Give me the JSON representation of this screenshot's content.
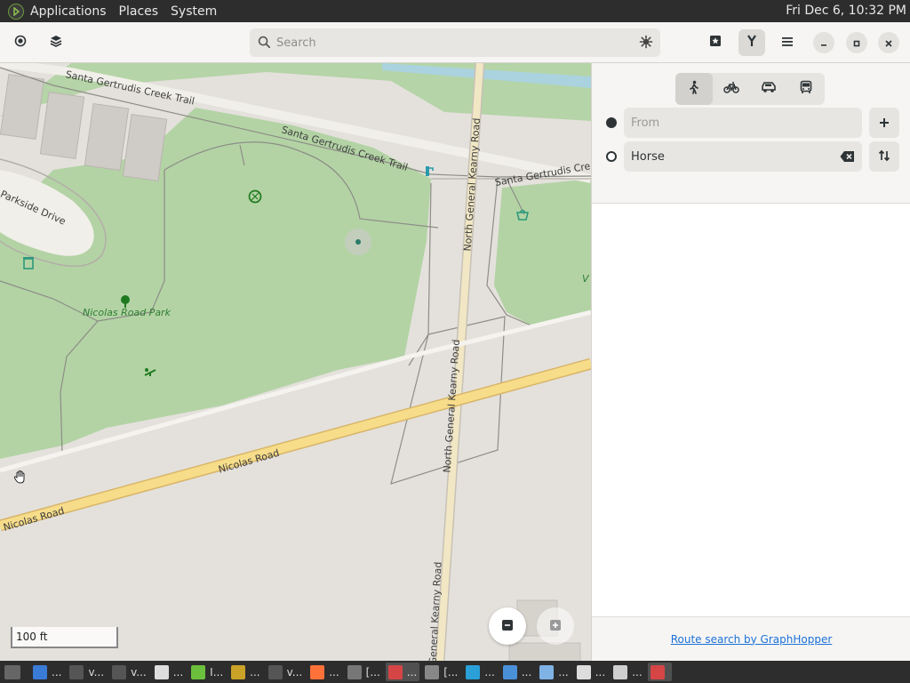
{
  "top_panel": {
    "menus": [
      "Applications",
      "Places",
      "System"
    ],
    "clock": "Fri Dec 6, 10:32 PM"
  },
  "header": {
    "search_placeholder": "Search"
  },
  "map": {
    "labels": {
      "trail_1": "Santa Gertrudis Creek Trail",
      "trail_2": "Santa Gertrudis Creek Trail",
      "trail_3": "Santa Gertrudis Cree",
      "parkside": "Parkside Drive",
      "park": "Nicolas Road Park",
      "kearny_1": "North General Kearny Road",
      "kearny_2": "North General Kearny Road",
      "kearny_3": "General Kearny Road",
      "nicolas_1": "Nicolas Road",
      "nicolas_2": "Nicolas Road",
      "edge_letter": "V"
    },
    "scale": "100 ft"
  },
  "sidebar": {
    "modes": [
      "walk",
      "bike",
      "car",
      "transit"
    ],
    "active_mode": "walk",
    "from_placeholder": "From",
    "to_value": "Horse",
    "footer_link": "Route search by GraphHopper"
  },
  "taskbar": {
    "items": [
      {
        "label": "...",
        "color": "#3a7bd5"
      },
      {
        "label": "v...",
        "color": "#555555"
      },
      {
        "label": "v...",
        "color": "#555555"
      },
      {
        "label": "...",
        "color": "#dddddd"
      },
      {
        "label": "I...",
        "color": "#6cbf3d"
      },
      {
        "label": "...",
        "color": "#c9a227"
      },
      {
        "label": "v...",
        "color": "#555555"
      },
      {
        "label": "...",
        "color": "#ff7139"
      },
      {
        "label": "[...",
        "color": "#777777"
      },
      {
        "label": "...",
        "color": "#d64545"
      },
      {
        "label": "[...",
        "color": "#888888"
      },
      {
        "label": "...",
        "color": "#2a9fd8"
      },
      {
        "label": "...",
        "color": "#4a90d9"
      },
      {
        "label": "...",
        "color": "#7fb2e5"
      },
      {
        "label": "...",
        "color": "#dddddd"
      },
      {
        "label": "...",
        "color": "#cfcfcf"
      },
      {
        "label": "",
        "color": "#d64545"
      }
    ]
  }
}
